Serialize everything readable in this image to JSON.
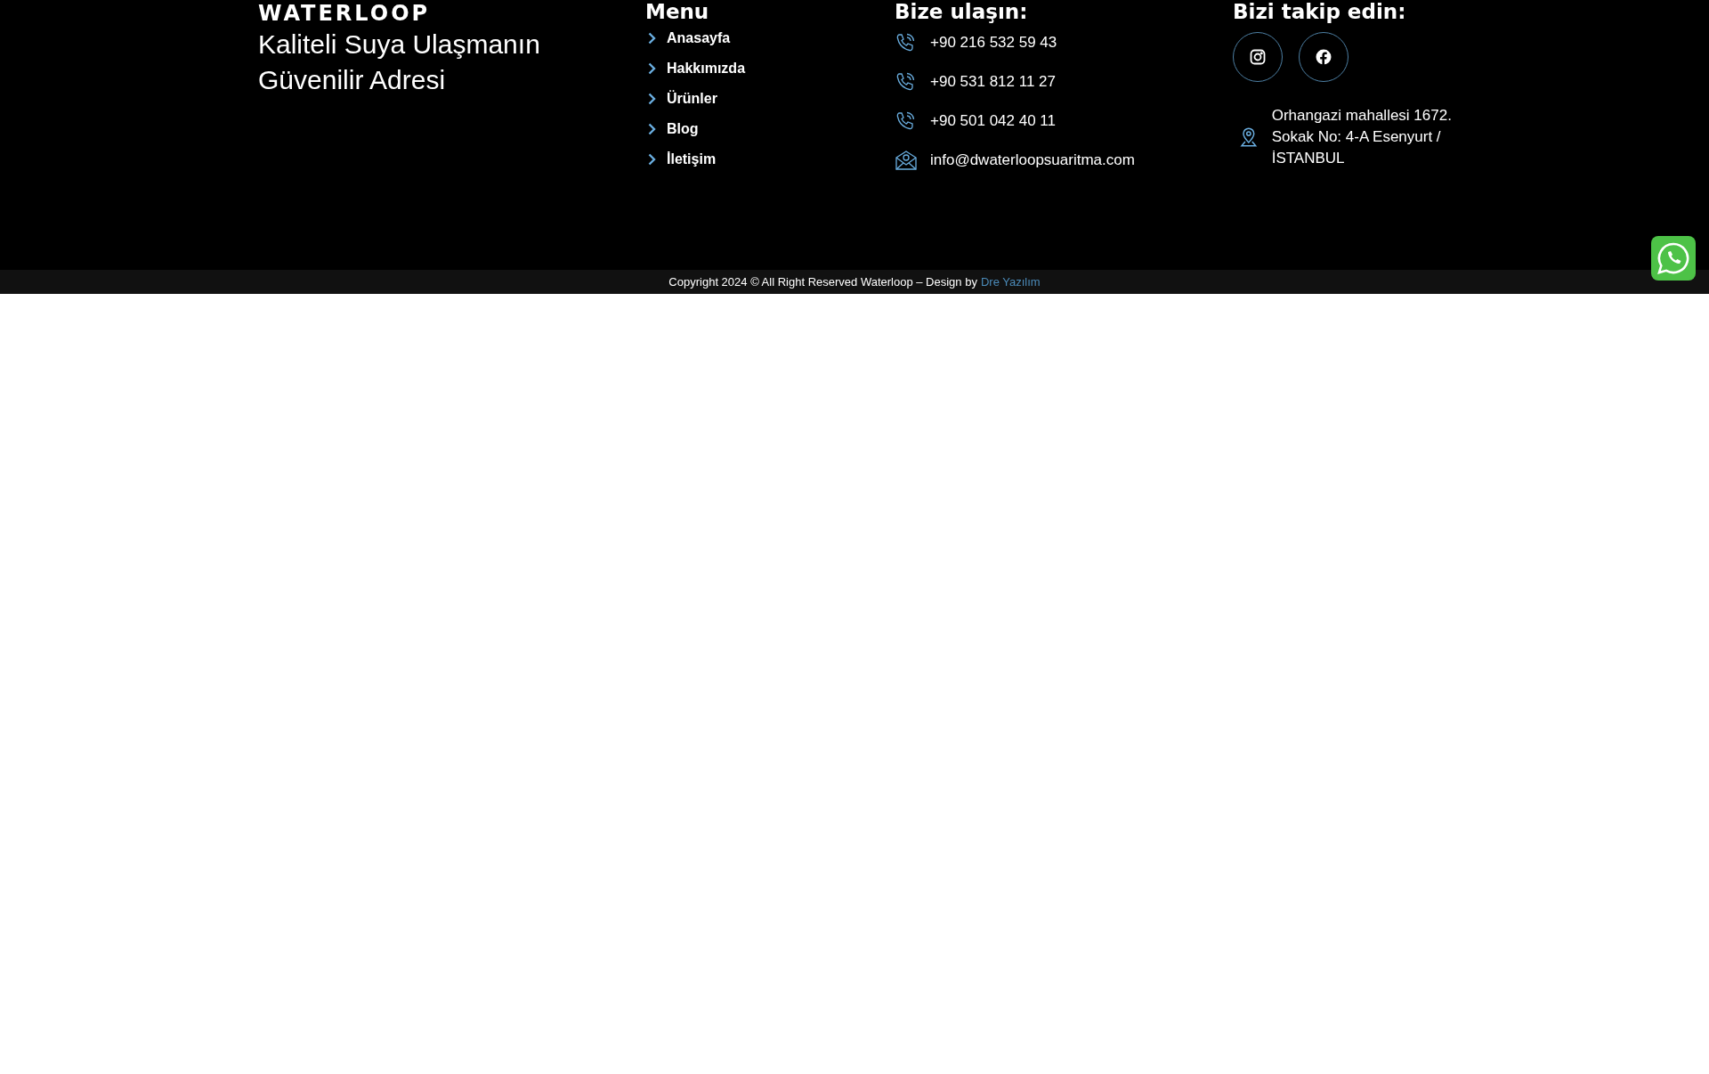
{
  "brand": {
    "logo": "WATERLOOP",
    "tagline": "Kaliteli Suya Ulaşmanın Güvenilir Adresi"
  },
  "menu": {
    "heading": "Menu",
    "items": [
      {
        "label": "Anasayfa"
      },
      {
        "label": "Hakkımızda"
      },
      {
        "label": "Ürünler"
      },
      {
        "label": "Blog"
      },
      {
        "label": "İletişim"
      }
    ]
  },
  "contact": {
    "heading": "Bize ulaşın:",
    "items": [
      {
        "kind": "phone",
        "text": "+90 216 532 59 43"
      },
      {
        "kind": "phone",
        "text": "+90 531 812 11 27"
      },
      {
        "kind": "phone",
        "text": "+90 501 042 40 11"
      },
      {
        "kind": "email",
        "text": "info@dwaterloopsuaritma.com"
      }
    ]
  },
  "social": {
    "heading": "Bizi takip edin:",
    "links": [
      {
        "kind": "instagram"
      },
      {
        "kind": "facebook"
      }
    ],
    "address": "Orhangazi mahallesi 1672. Sokak No: 4-A Esenyurt / İSTANBUL"
  },
  "copyright": {
    "text": "Copyright 2024 © All Right Reserved Waterloop – Design by",
    "link": "Dre Yazılım"
  }
}
